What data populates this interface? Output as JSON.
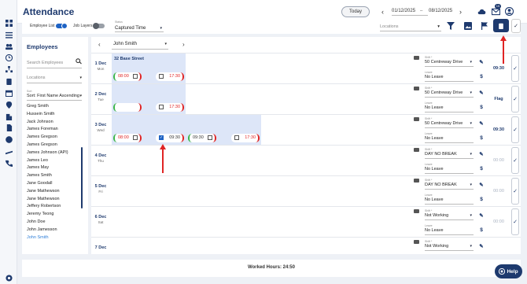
{
  "header": {
    "title": "Attendance",
    "today_label": "Today",
    "date_from": "01/12/2025",
    "date_sep": "–",
    "date_to": "08/12/2025",
    "notifications_count": "15"
  },
  "filters": {
    "employee_list_label": "Employee List",
    "job_layers_label": "Job Layers",
    "status_label": "Status",
    "status_value": "Captured Time",
    "locations_placeholder": "Locations"
  },
  "employees": {
    "title": "Employees",
    "search_placeholder": "Search Employees",
    "locations_placeholder": "Locations",
    "sort_label": "Sort",
    "sort_value": "Sort: First Name Ascending",
    "list": [
      "Greg Smith",
      "Hussein Smith",
      "Jack Johnson",
      "James Foreman",
      "James Gregson",
      "James Gregson",
      "James Johnson (API)",
      "James Leo",
      "James May",
      "James Smith",
      "Jane Goodall",
      "Jane Mathewson",
      "Jane Mathewson",
      "Jeffery Robertson",
      "Jeremy Teong",
      "John Doe",
      "John Jamesson",
      "John Smith"
    ],
    "selected": "John Smith"
  },
  "schedule": {
    "current_employee": "John Smith",
    "shift_label": "Shift *",
    "leave_label": "Leave",
    "days": [
      {
        "date": "1 Dec",
        "weekday": "Mon",
        "location": "32 Base Street",
        "in": "08:00",
        "out": "17:30",
        "shift": "50 Centreway Drive",
        "leave": "No Leave",
        "hours": "09:30"
      },
      {
        "date": "2 Dec",
        "weekday": "Tue",
        "location": "",
        "in": "",
        "out": "17:30",
        "shift": "50 Centreway Drive",
        "leave": "No Leave",
        "hours": "Flag"
      },
      {
        "date": "3 Dec",
        "weekday": "Wed",
        "location": "",
        "in": "08:00",
        "out": "09:30",
        "in2": "09:30",
        "out2": "17:30",
        "shift": "50 Centreway Drive",
        "leave": "No Leave",
        "hours": "09:30"
      },
      {
        "date": "4 Dec",
        "weekday": "Thu",
        "shift": "DAY NO BREAK",
        "leave": "No Leave",
        "hours": "00:00"
      },
      {
        "date": "5 Dec",
        "weekday": "Fri",
        "shift": "DAY NO BREAK",
        "leave": "No Leave",
        "hours": "00:00"
      },
      {
        "date": "6 Dec",
        "weekday": "Sat",
        "shift": "Not Working",
        "leave": "No Leave",
        "hours": "00:00"
      },
      {
        "date": "7 Dec",
        "weekday": "Sun",
        "shift": "Not Working",
        "leave": "",
        "hours": ""
      }
    ]
  },
  "footer": {
    "worked_hours": "Worked Hours: 24:50"
  },
  "help_label": "Help",
  "colors": {
    "brand": "#1e3a6e",
    "accent_blue": "#1e63c4",
    "shift_bg": "#dde6f8",
    "clock_in_ok": "#3bb54a",
    "clock_missing": "#e02424"
  }
}
